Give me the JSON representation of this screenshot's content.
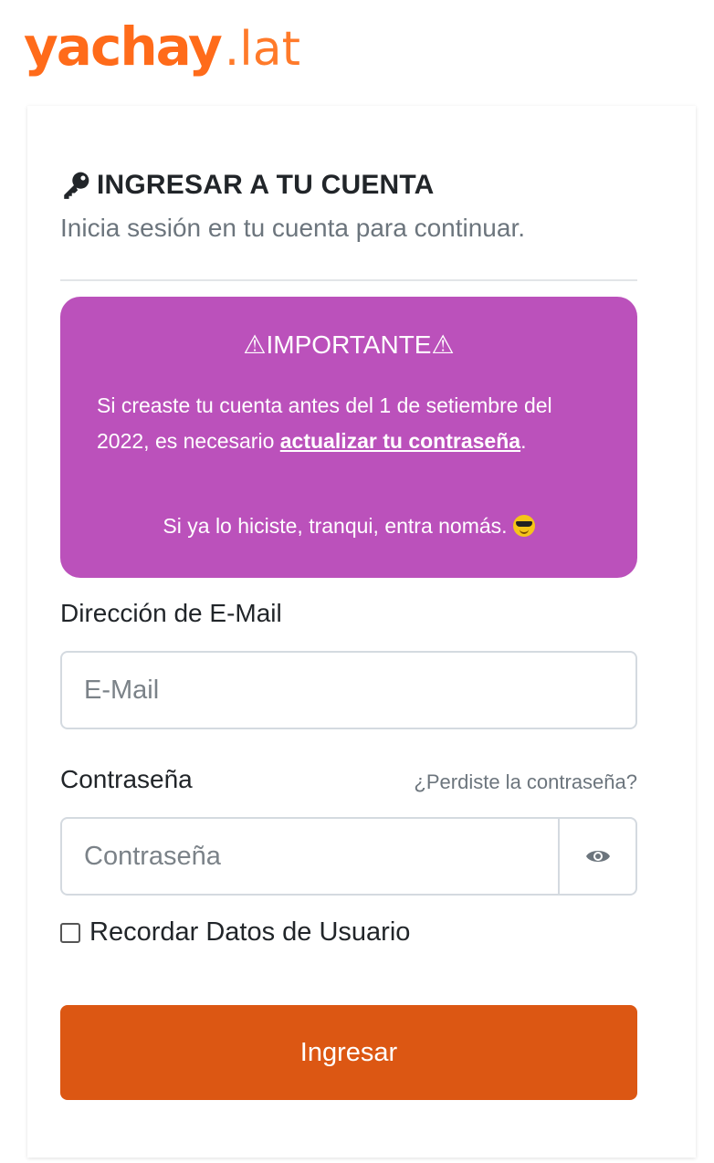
{
  "brand": {
    "logo_main": "yachay",
    "logo_tld": ".lat",
    "logo_color": "#ff6b1a"
  },
  "header": {
    "title_icon": "key-icon",
    "title": "INGRESAR A TU CUENTA",
    "subtitle": "Inicia sesión en tu cuenta para continuar."
  },
  "notice": {
    "title": "⚠IMPORTANTE⚠",
    "body_prefix": "Si creaste tu cuenta antes del 1 de setiembre del 2022, es necesario ",
    "link_text": "actualizar tu contraseña",
    "body_suffix": ".",
    "footer": "Si ya lo hiciste, tranqui, entra nomás.",
    "footer_icon": "sunglasses-emoji-icon",
    "background_color": "#bb51bb"
  },
  "form": {
    "email_label": "Dirección de E-Mail",
    "email_placeholder": "E-Mail",
    "email_value": "",
    "password_label": "Contraseña",
    "forgot_link": "¿Perdiste la contraseña?",
    "password_placeholder": "Contraseña",
    "password_value": "",
    "toggle_icon": "eye-icon",
    "remember_label": "Recordar Datos de Usuario",
    "remember_checked": false,
    "submit_label": "Ingresar",
    "submit_color": "#dc5713"
  }
}
